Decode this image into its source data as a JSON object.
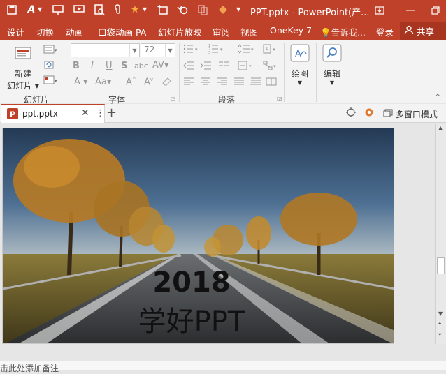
{
  "titlebar": {
    "document_title": "PPT.pptx - PowerPoint(产...",
    "bg_color": "#c0412a"
  },
  "menu_tabs": [
    "设计",
    "切换",
    "动画",
    "口袋动画 PA",
    "幻灯片放映",
    "审阅",
    "视图",
    "OneKey 7"
  ],
  "tell_me": "告诉我...",
  "login": "登录",
  "share": "共享",
  "ribbon": {
    "new_slide_line1": "新建",
    "new_slide_line2": "幻灯片",
    "group_slides": "幻灯片",
    "group_font": "字体",
    "group_paragraph": "段落",
    "font_name": "",
    "font_size": "72",
    "drawing": "绘图",
    "editing": "编辑",
    "bold": "B",
    "italic": "I",
    "underline": "U",
    "shadow": "S",
    "strike": "abc"
  },
  "doc_tab": {
    "filename": "ppt.pptx",
    "multi_window": "多窗口模式"
  },
  "slide": {
    "line1": "2018",
    "line2": "学好PPT"
  },
  "notes": {
    "placeholder": "单击此处添加备注"
  }
}
